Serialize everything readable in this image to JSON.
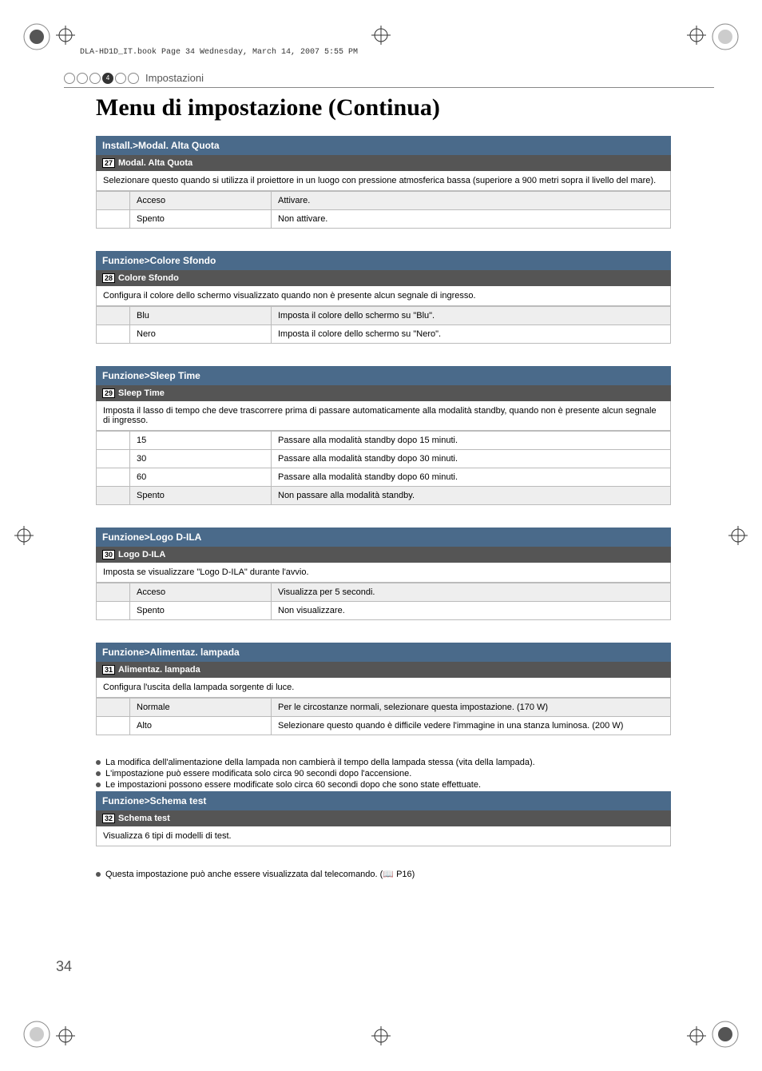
{
  "header_line": "DLA-HD1D_IT.book  Page 34  Wednesday, March 14, 2007  5:55 PM",
  "section_number": "4",
  "section_label": "Impostazioni",
  "title": "Menu di impostazione (Continua)",
  "page_number": "34",
  "blocks": [
    {
      "bar": "Install.>Modal. Alta Quota",
      "sub_num": "27",
      "sub_title": "Modal. Alta Quota",
      "desc": "Selezionare questo quando si utilizza il proiettore in un luogo con pressione atmosferica bassa (superiore a 900 metri sopra il livello del mare).",
      "rows": [
        {
          "k": "Acceso",
          "v": "Attivare.",
          "shaded": true
        },
        {
          "k": "Spento",
          "v": "Non attivare."
        }
      ]
    },
    {
      "bar": "Funzione>Colore Sfondo",
      "sub_num": "28",
      "sub_title": "Colore Sfondo",
      "desc": "Configura il colore dello schermo visualizzato quando non è presente alcun segnale di ingresso.",
      "rows": [
        {
          "k": "Blu",
          "v": "Imposta il colore dello schermo su \"Blu\".",
          "shaded": true
        },
        {
          "k": "Nero",
          "v": "Imposta il colore dello schermo su \"Nero\"."
        }
      ]
    },
    {
      "bar": "Funzione>Sleep Time",
      "sub_num": "29",
      "sub_title": "Sleep Time",
      "desc": "Imposta il lasso di tempo che deve trascorrere prima di passare automaticamente alla modalità standby, quando non è presente alcun segnale di ingresso.",
      "rows": [
        {
          "k": "15",
          "v": "Passare alla modalità standby dopo 15 minuti."
        },
        {
          "k": "30",
          "v": "Passare alla modalità standby dopo 30 minuti."
        },
        {
          "k": "60",
          "v": "Passare alla modalità standby dopo 60 minuti."
        },
        {
          "k": "Spento",
          "v": "Non passare alla modalità standby.",
          "shaded": true
        }
      ]
    },
    {
      "bar": "Funzione>Logo D-ILA",
      "sub_num": "30",
      "sub_title": "Logo D-ILA",
      "desc": "Imposta se visualizzare \"Logo D-ILA\" durante l'avvio.",
      "rows": [
        {
          "k": "Acceso",
          "v": "Visualizza per 5 secondi.",
          "shaded": true
        },
        {
          "k": "Spento",
          "v": "Non visualizzare."
        }
      ]
    },
    {
      "bar": "Funzione>Alimentaz. lampada",
      "sub_num": "31",
      "sub_title": "Alimentaz. lampada",
      "desc": "Configura l'uscita della lampada sorgente di luce.",
      "rows": [
        {
          "k": "Normale",
          "v": "Per le circostanze normali, selezionare questa impostazione. (170 W)",
          "shaded": true
        },
        {
          "k": "Alto",
          "v": "Selezionare questo quando è difficile vedere l'immagine in una stanza luminosa. (200 W)"
        }
      ],
      "notes": [
        "La modifica dell'alimentazione della lampada non cambierà il tempo della lampada stessa (vita della lampada).",
        "L'impostazione può essere modificata solo circa 90 secondi dopo l'accensione.",
        "Le impostazioni possono essere modificate solo circa 60 secondi dopo che sono state effettuate."
      ]
    },
    {
      "bar": "Funzione>Schema test",
      "sub_num": "32",
      "sub_title": "Schema test",
      "desc": "Visualizza 6 tipi di modelli di test.",
      "rows": [],
      "notes": [
        "Questa impostazione può anche essere visualizzata dal telecomando. (📖 P16)"
      ]
    }
  ]
}
